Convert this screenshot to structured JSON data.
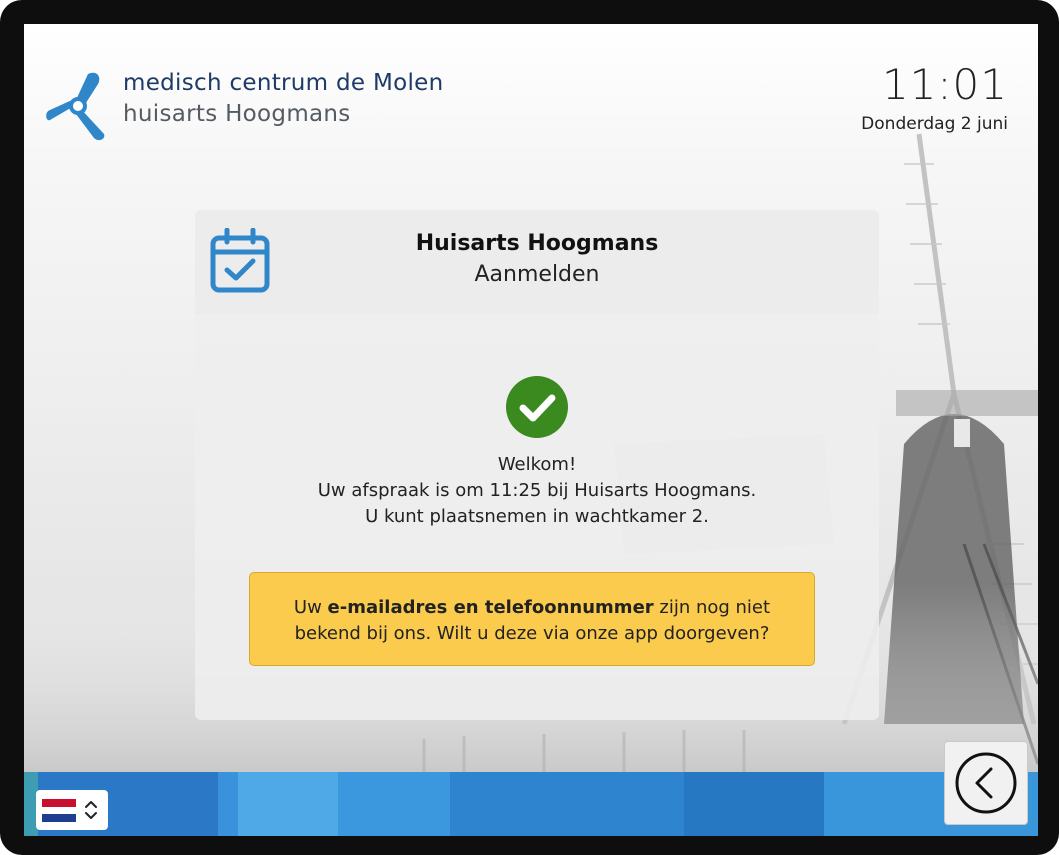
{
  "brand": {
    "line1": "medisch centrum de Molen",
    "line2": "huisarts Hoogmans",
    "logo_icon": "windmill-propeller-icon",
    "primary_color": "#2f86c8"
  },
  "clock": {
    "time": "11:01",
    "date": "Donderdag 2 juni"
  },
  "card": {
    "icon": "calendar-check-icon",
    "title": "Huisarts Hoogmans",
    "subtitle": "Aanmelden",
    "status_icon": "check-circle-icon",
    "status_color": "#3a8a1f",
    "message_line1": "Welkom!",
    "message_line2": "Uw afspraak is om 11:25 bij Huisarts Hoogmans.",
    "message_line3": "U kunt plaatsnemen in wachtkamer 2."
  },
  "notice": {
    "pre": "Uw ",
    "bold": "e-mailadres en telefoonnummer",
    "post_line1": " zijn nog niet",
    "line2": "bekend bij ons. Wilt u deze via onze app doorgeven?",
    "background": "#fbcb4d"
  },
  "footer": {
    "language_flag": "netherlands-flag-icon",
    "language_toggle_icon": "chevron-updown-icon",
    "back_icon": "back-arrow-circle-icon"
  }
}
